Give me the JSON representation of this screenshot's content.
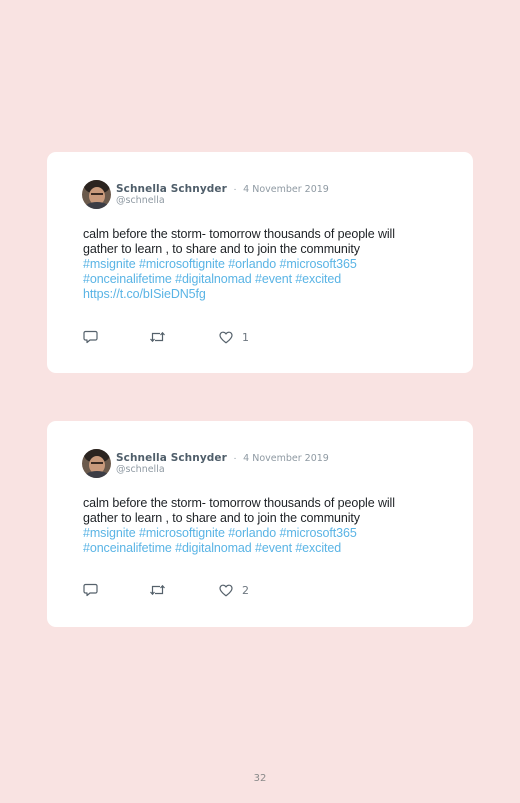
{
  "tweets": [
    {
      "author": "Schnella Schnyder",
      "separator": "·",
      "date": "4 November 2019",
      "handle": "@schnella",
      "text_lines": [
        "calm before the storm- tomorrow thousands of people will",
        "gather to learn , to share and to join the community"
      ],
      "link_lines": [
        "#msignite #microsoftignite #orlando #microsoft365",
        "#onceinalifetime #digitalnomad #event #excited",
        "https://t.co/bISieDN5fg"
      ],
      "likes": "1",
      "icons": {
        "reply": "reply-icon",
        "retweet": "retweet-icon",
        "like": "heart-icon"
      }
    },
    {
      "author": "Schnella Schnyder",
      "separator": "·",
      "date": "4 November 2019",
      "handle": "@schnella",
      "text_lines": [
        "calm before the storm- tomorrow thousands of people will",
        "gather to learn , to share and to join the community"
      ],
      "link_lines": [
        "#msignite #microsoftignite #orlando #microsoft365",
        "#onceinalifetime #digitalnomad #event #excited"
      ],
      "likes": "2",
      "icons": {
        "reply": "reply-icon",
        "retweet": "retweet-icon",
        "like": "heart-icon"
      }
    }
  ],
  "page_number": "32",
  "colors": {
    "background": "#f9e3e2",
    "card": "#ffffff",
    "link": "#5ab4e5",
    "text": "#1e2226",
    "muted": "#8e99a2"
  }
}
